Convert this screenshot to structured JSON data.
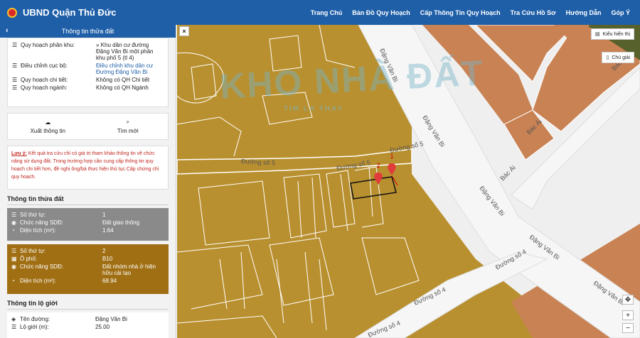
{
  "app": {
    "title": "UBND Quận Thủ Đức"
  },
  "nav": [
    "Trang Chủ",
    "Bản Đồ Quy Hoạch",
    "Cấp Thông Tin Quy Hoạch",
    "Tra Cứu Hồ Sơ",
    "Hướng Dẫn",
    "Góp Ý"
  ],
  "panel": {
    "title": "Thông tin thửa đất",
    "planning": [
      {
        "label": "Quy hoạch phân khu:",
        "value": "» Khu dân cư đường Đặng Văn Bi một phần khu phố 5 (tl 4)"
      },
      {
        "label": "Điều chỉnh cục bộ:",
        "value": "Điều chỉnh khu dân cư Đường Đặng Văn Bi"
      },
      {
        "label": "Quy hoạch chi tiết:",
        "value": "Không có QH Chi tiết"
      },
      {
        "label": "Quy hoạch ngành:",
        "value": "Không có QH Ngành"
      }
    ],
    "actions": {
      "export": "Xuất thông tin",
      "search": "Tìm mới"
    },
    "note": {
      "prefix": "Lưu ý:",
      "text": " Kết quả tra cứu chỉ có giá trị tham khảo thông tin về chức năng sử dụng đất. Trong trường hợp cần cung cấp thông tin quy hoạch chi tiết hơn, đề nghị ông/bà thực hiện thủ tục Cấp chứng chỉ quy hoạch."
    },
    "parcel_section": "Thông tin thửa đất",
    "parcel1": [
      {
        "label": "Số thứ tự:",
        "value": "1"
      },
      {
        "label": "Chức năng SDĐ:",
        "value": "Đất giao thông"
      },
      {
        "label": "Diện tích (m²):",
        "value": "1.64"
      }
    ],
    "parcel2": [
      {
        "label": "Số thứ tự:",
        "value": "2"
      },
      {
        "label": "Ô phố:",
        "value": "B10"
      },
      {
        "label": "Chức năng SDĐ:",
        "value": "Đất nhóm nhà ở hiện hữu cải tạo"
      },
      {
        "label": "Diện tích (m²):",
        "value": "68.94"
      }
    ],
    "road_section": "Thông tin lộ giới",
    "road": [
      {
        "label": "Tên đường:",
        "value": "Đặng Văn Bi"
      },
      {
        "label": "Lộ giới (m):",
        "value": "25.00"
      }
    ]
  },
  "map": {
    "legend_button": "Kiểu hiển thị",
    "note_button": "Chú giải",
    "roads": [
      "Đặng Văn Bi",
      "Đặng Văn Bi",
      "Đặng Văn Bi",
      "Đặng Văn Bi",
      "Đặng Văn Bi",
      "Đường số 5",
      "Đường số 5",
      "Đường số 5",
      "Đường số 4",
      "Đường số 4",
      "Đường số 4",
      "Bác Ái",
      "Bác Ái",
      "Bác"
    ],
    "markers": [
      "1",
      "2"
    ],
    "zoom_in": "+",
    "zoom_out": "−",
    "close": "×",
    "watermark": "KHO NHÀ ĐẤT",
    "watermark_sub": "TIM LA THAY"
  },
  "colors": {
    "accent": "#1f5fa8",
    "land": "#b9902f",
    "commercial": "#c98253",
    "road": "#f4f4f4"
  }
}
